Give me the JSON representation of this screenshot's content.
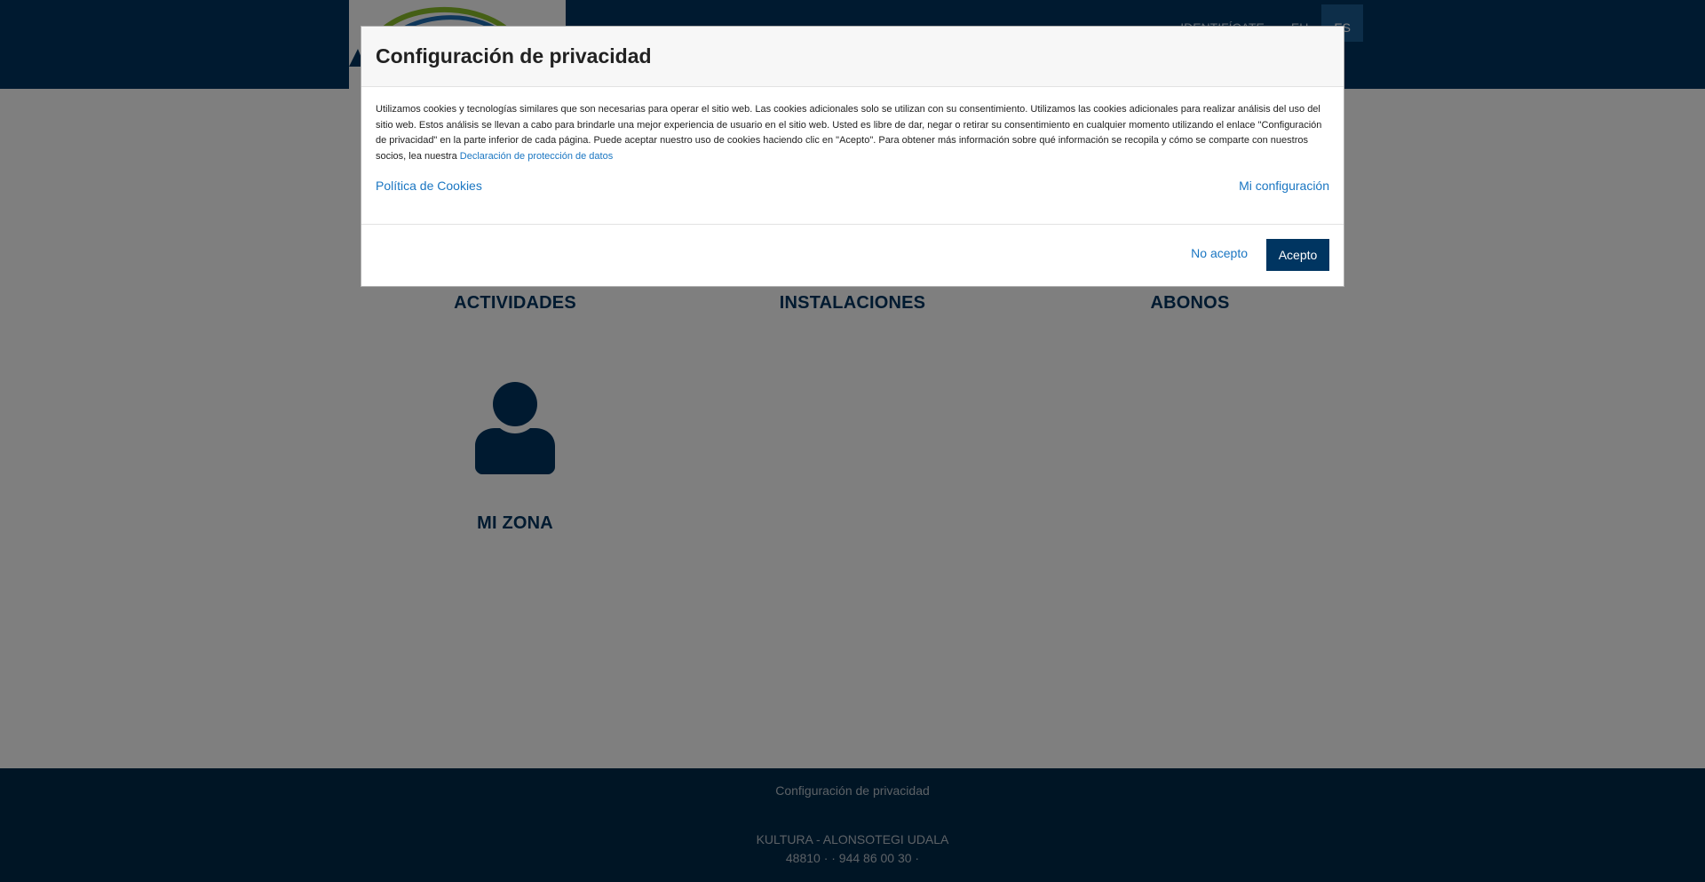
{
  "header": {
    "nav": {
      "login": "IDENTIFÍCATE",
      "lang_eu": "EU",
      "lang_es": "ES"
    }
  },
  "tiles": [
    {
      "label": "ACTIVIDADES",
      "icon": "activities-icon"
    },
    {
      "label": "INSTALACIONES",
      "icon": "facilities-icon"
    },
    {
      "label": "ABONOS",
      "icon": "passes-icon"
    },
    {
      "label": "MI ZONA",
      "icon": "user-icon"
    }
  ],
  "footer": {
    "privacy_link": "Configuración de privacidad",
    "organization": "KULTURA - ALONSOTEGI UDALA",
    "address": "48810 · · 944 86 00 30 ·"
  },
  "modal": {
    "title": "Configuración de privacidad",
    "body_text": "Utilizamos cookies y tecnologías similares que son necesarias para operar el sitio web. Las cookies adicionales solo se utilizan con su consentimiento. Utilizamos las cookies adicionales para realizar análisis del uso del sitio web. Estos análisis se llevan a cabo para brindarle una mejor experiencia de usuario en el sitio web. Usted es libre de dar, negar o retirar su consentimiento en cualquier momento utilizando el enlace \"Configuración de privacidad\" en la parte inferior de cada página. Puede aceptar nuestro uso de cookies haciendo clic en \"Acepto\". Para obtener más información sobre qué información se recopila y cómo se comparte con nuestros socios, lea nuestra",
    "data_protection_link": "Declaración de protección de datos",
    "cookie_policy_link": "Política de Cookies",
    "my_settings_link": "Mi configuración",
    "reject_button": "No acepto",
    "accept_button": "Acepto"
  },
  "colors": {
    "primary": "#003561",
    "footer": "#002a4a",
    "link": "#1a76c2"
  }
}
